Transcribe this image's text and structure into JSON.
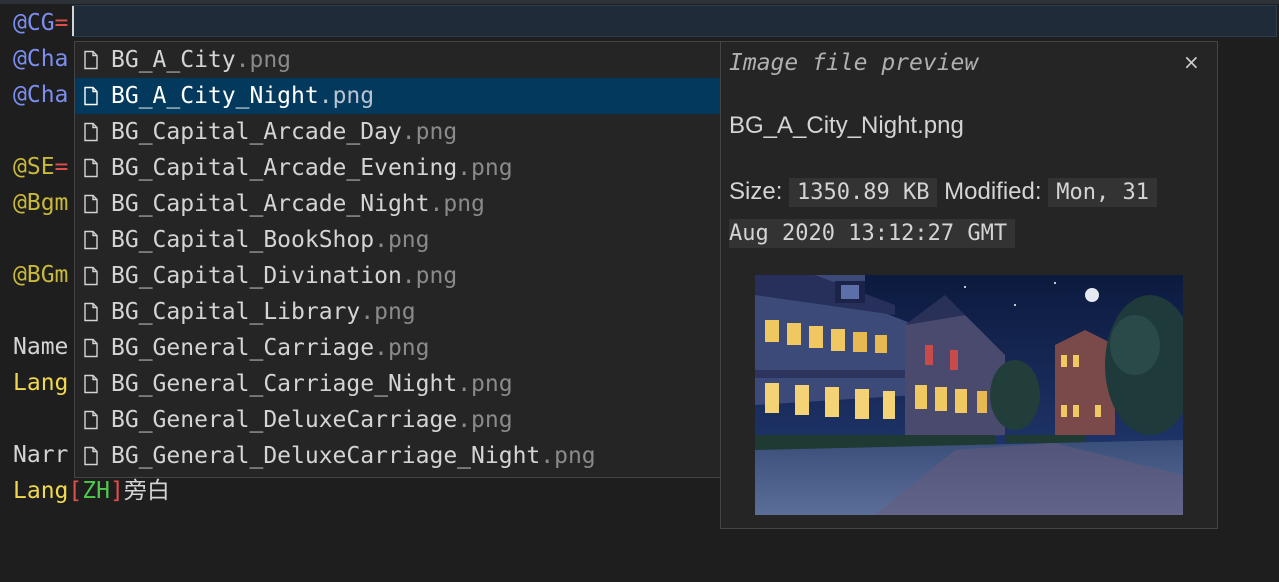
{
  "editor": {
    "lines": [
      {
        "prefix": "@CG",
        "op": "=",
        "rest": "",
        "prefix_color": "#7c8ff0",
        "op_color": "#e0504a"
      },
      {
        "prefix": "@Cha",
        "op": "",
        "rest": "",
        "prefix_color": "#7c8ff0"
      },
      {
        "prefix": "@Cha",
        "op": "",
        "rest": "",
        "prefix_color": "#7c8ff0"
      },
      {
        "prefix": "@SE",
        "op": "=",
        "rest": "",
        "prefix_color": "#c8b93a",
        "op_color": "#e0504a"
      },
      {
        "prefix": "@Bgm",
        "op": "",
        "rest": "",
        "prefix_color": "#c8b93a"
      },
      {
        "prefix": "@BGm",
        "op": "",
        "rest": "",
        "prefix_color": "#c8b93a"
      },
      {
        "prefix": "Name",
        "op": "",
        "rest": "",
        "prefix_color": "#d4d4d4"
      },
      {
        "prefix": "Lang",
        "op": "",
        "rest": "",
        "prefix_color": "#f2d84f"
      },
      {
        "prefix": "Narr",
        "op": "",
        "rest": "",
        "prefix_color": "#d4d4d4"
      }
    ],
    "last_line": {
      "keyword": "Lang",
      "bracket_open": "[",
      "tag": "ZH",
      "bracket_close": "]",
      "text": "旁白"
    }
  },
  "suggestions": [
    {
      "name": "BG_A_City",
      "ext": ".png",
      "selected": false
    },
    {
      "name": "BG_A_City_Night",
      "ext": ".png",
      "selected": true
    },
    {
      "name": "BG_Capital_Arcade_Day",
      "ext": ".png",
      "selected": false
    },
    {
      "name": "BG_Capital_Arcade_Evening",
      "ext": ".png",
      "selected": false
    },
    {
      "name": "BG_Capital_Arcade_Night",
      "ext": ".png",
      "selected": false
    },
    {
      "name": "BG_Capital_BookShop",
      "ext": ".png",
      "selected": false
    },
    {
      "name": "BG_Capital_Divination",
      "ext": ".png",
      "selected": false
    },
    {
      "name": "BG_Capital_Library",
      "ext": ".png",
      "selected": false
    },
    {
      "name": "BG_General_Carriage",
      "ext": ".png",
      "selected": false
    },
    {
      "name": "BG_General_Carriage_Night",
      "ext": ".png",
      "selected": false
    },
    {
      "name": "BG_General_DeluxeCarriage",
      "ext": ".png",
      "selected": false
    },
    {
      "name": "BG_General_DeluxeCarriage_Night",
      "ext": ".png",
      "selected": false
    }
  ],
  "preview": {
    "title": "Image file preview",
    "close_glyph": "×",
    "file_name": "BG_A_City_Night.png",
    "size_label": "Size:",
    "size_value": "1350.89 KB",
    "modified_label": "Modified:",
    "modified_value_1": "Mon, 31",
    "modified_value_2": "Aug 2020 13:12:27 GMT",
    "image_icon": "night-town-street-image"
  },
  "colors": {
    "background": "#1e1e1e",
    "selection": "#04395e",
    "panel": "#252526"
  }
}
